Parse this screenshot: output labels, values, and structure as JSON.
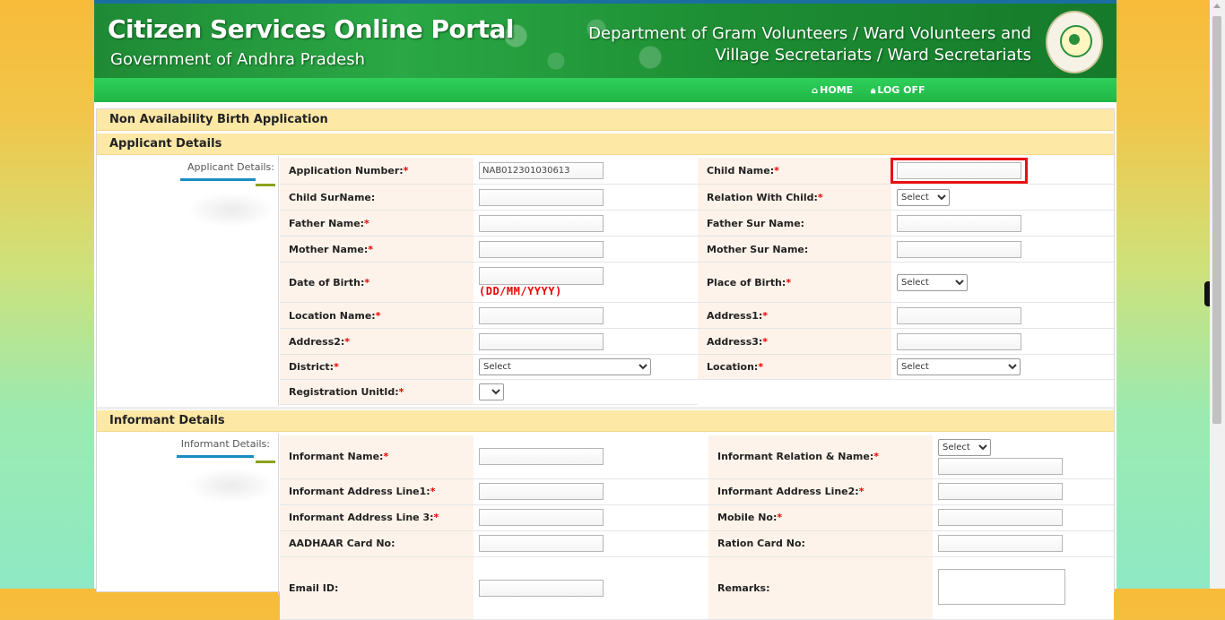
{
  "header": {
    "title": "Citizen Services Online Portal",
    "subtitle": "Government of Andhra Pradesh",
    "department_line1": "Department of Gram Volunteers / Ward Volunteers and",
    "department_line2": "Village Secretariats / Ward Secretariats"
  },
  "nav": {
    "home": "HOME",
    "logoff": "LOG OFF"
  },
  "form": {
    "page_title": "Non Availability Birth Application",
    "applicant_section": {
      "heading": "Applicant Details",
      "side_label": "Applicant Details:",
      "fields": {
        "application_number": {
          "label": "Application Number:",
          "value": "NAB012301030613"
        },
        "child_name": {
          "label": "Child Name:",
          "value": ""
        },
        "child_surname": {
          "label": "Child SurName:",
          "value": ""
        },
        "relation_with_child": {
          "label": "Relation With Child:",
          "selected": "Select"
        },
        "father_name": {
          "label": "Father Name:",
          "value": ""
        },
        "father_surname": {
          "label": "Father Sur Name:",
          "value": ""
        },
        "mother_name": {
          "label": "Mother Name:",
          "value": ""
        },
        "mother_surname": {
          "label": "Mother Sur Name:",
          "value": ""
        },
        "date_of_birth": {
          "label": "Date of Birth:",
          "value": "",
          "hint": "(DD/MM/YYYY)"
        },
        "place_of_birth": {
          "label": "Place of Birth:",
          "selected": "Select"
        },
        "location_name": {
          "label": "Location Name:",
          "value": ""
        },
        "address1": {
          "label": "Address1:",
          "value": ""
        },
        "address2": {
          "label": "Address2:",
          "value": ""
        },
        "address3": {
          "label": "Address3:",
          "value": ""
        },
        "district": {
          "label": "District:",
          "selected": "Select"
        },
        "location": {
          "label": "Location:",
          "selected": "Select"
        },
        "registration_unit_id": {
          "label": "Registration UnitId:",
          "selected": ""
        }
      }
    },
    "informant_section": {
      "heading": "Informant Details",
      "side_label": "Informant Details:",
      "fields": {
        "informant_name": {
          "label": "Informant Name:",
          "value": ""
        },
        "informant_relation_name": {
          "label": "Informant Relation & Name:",
          "selected": "Select",
          "value": ""
        },
        "address_line1": {
          "label": "Informant Address Line1:",
          "value": ""
        },
        "address_line2": {
          "label": "Informant Address Line2:",
          "value": ""
        },
        "address_line3": {
          "label": "Informant Address Line 3:",
          "value": ""
        },
        "mobile_no": {
          "label": "Mobile No:",
          "value": ""
        },
        "aadhaar_card_no": {
          "label": "AADHAAR Card No:",
          "value": ""
        },
        "ration_card_no": {
          "label": "Ration Card No:",
          "value": ""
        },
        "email_id": {
          "label": "Email ID:",
          "value": ""
        },
        "remarks": {
          "label": "Remarks:",
          "value": ""
        }
      }
    },
    "required_mark": "*"
  },
  "colors": {
    "header_green": "#1e8f34",
    "nav_green": "#22c04b",
    "section_bg": "#fde8a6",
    "label_bg": "#fdf3ea",
    "required_red": "#ee0000",
    "highlight_red": "#ea1010",
    "rule_blue": "#1a8cc4",
    "rule_olive": "#8aa21c"
  },
  "icons": {
    "home": "home-icon",
    "logoff": "lock-icon",
    "emblem": "ap-emblem-icon"
  }
}
